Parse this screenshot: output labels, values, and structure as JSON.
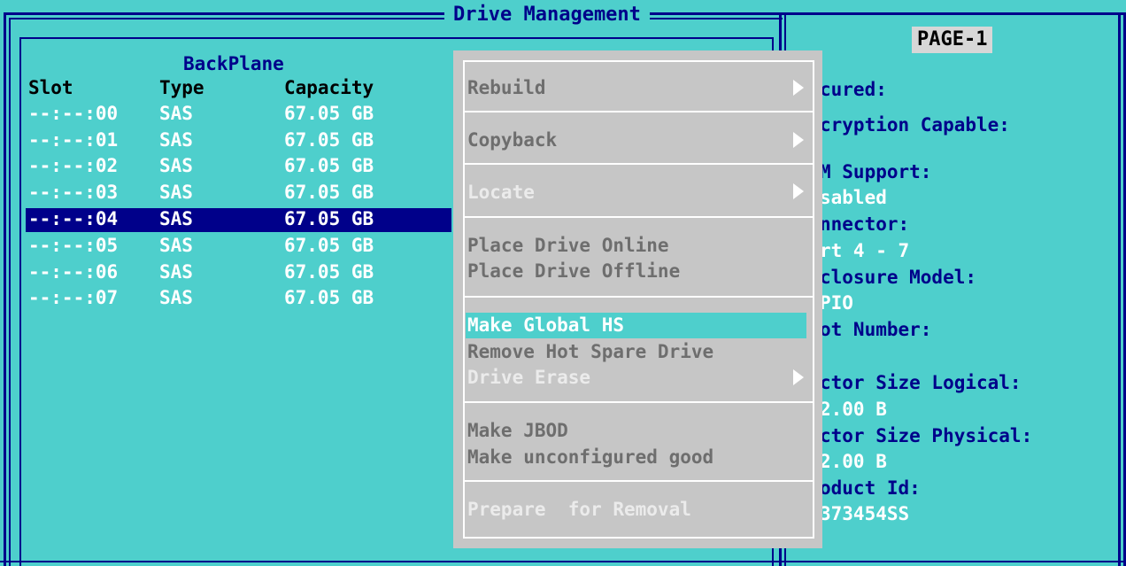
{
  "window": {
    "title": "Drive Management"
  },
  "left": {
    "header": "BackPlane",
    "columns": {
      "slot": "Slot",
      "type": "Type",
      "capacity": "Capacity"
    },
    "rows": [
      {
        "slot": "--:--:00",
        "type": "SAS",
        "capacity": "67.05 GB"
      },
      {
        "slot": "--:--:01",
        "type": "SAS",
        "capacity": "67.05 GB"
      },
      {
        "slot": "--:--:02",
        "type": "SAS",
        "capacity": "67.05 GB"
      },
      {
        "slot": "--:--:03",
        "type": "SAS",
        "capacity": "67.05 GB"
      },
      {
        "slot": "--:--:04",
        "type": "SAS",
        "capacity": "67.05 GB"
      },
      {
        "slot": "--:--:05",
        "type": "SAS",
        "capacity": "67.05 GB"
      },
      {
        "slot": "--:--:06",
        "type": "SAS",
        "capacity": "67.05 GB"
      },
      {
        "slot": "--:--:07",
        "type": "SAS",
        "capacity": "67.05 GB"
      }
    ]
  },
  "right": {
    "page_label": "PAGE-1",
    "lines": [
      "cured:",
      "cryption Capable:",
      "M Support:",
      "sabled",
      "nnector:",
      "rt 4 - 7",
      "closure Model:",
      "PIO",
      "ot Number:",
      "ctor Size Logical:",
      "2.00 B",
      "ctor Size Physical:",
      "2.00 B",
      "oduct Id:",
      "373454SS"
    ]
  },
  "menu": {
    "items": {
      "rebuild": "Rebuild",
      "copyback": "Copyback",
      "locate": "Locate",
      "place_online": "Place Drive Online",
      "place_offline": "Place Drive Offline",
      "make_global_hs": "Make Global HS",
      "remove_hot_spare": "Remove Hot Spare Drive",
      "drive_erase": "Drive Erase",
      "make_jbod": "Make JBOD",
      "make_unconfigured_good": "Make unconfigured good",
      "prepare_for_removal": "Prepare  for Removal"
    }
  },
  "colors": {
    "background": "#4ecfcc",
    "frame": "#00008a",
    "menu_bg": "#c6c6c6",
    "menu_text": "#6e6e6e",
    "highlight": "#4ecfcc"
  }
}
